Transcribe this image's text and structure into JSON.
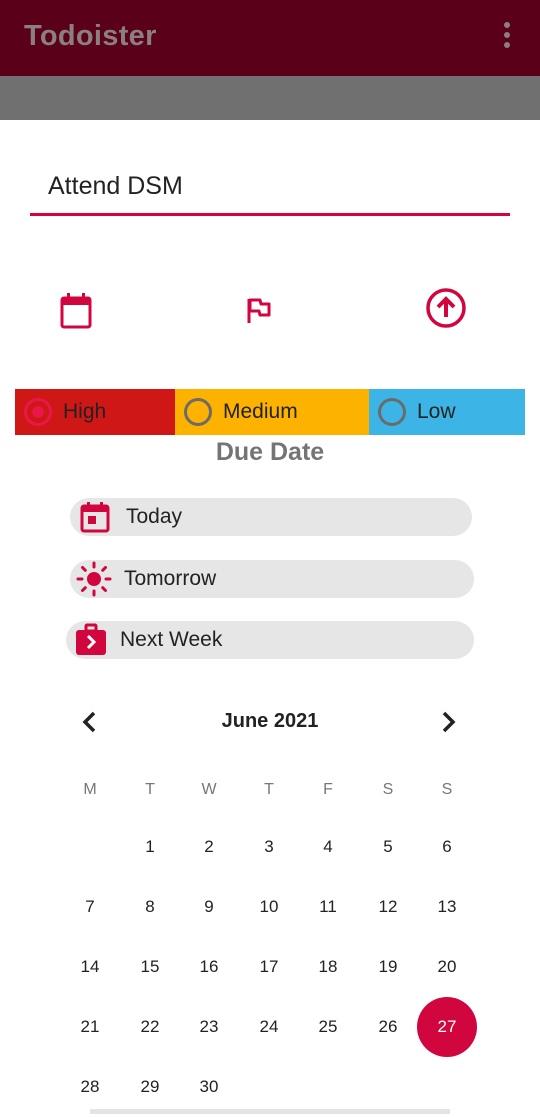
{
  "app": {
    "title": "Todoister",
    "menu_icon": "more-vert-icon"
  },
  "task": {
    "value": "Attend DSM"
  },
  "actions": [
    {
      "name": "calendar-icon"
    },
    {
      "name": "flag-icon"
    },
    {
      "name": "save-arrow-up-icon"
    }
  ],
  "priority": {
    "options": [
      {
        "label": "High",
        "color": "#cf1716",
        "selected": true
      },
      {
        "label": "Medium",
        "color": "#feb200",
        "selected": false
      },
      {
        "label": "Low",
        "color": "#3cb5e6",
        "selected": false
      }
    ]
  },
  "due": {
    "title": "Due Date",
    "chips": [
      {
        "label": "Today",
        "icon": "calendar-today-icon"
      },
      {
        "label": "Tomorrow",
        "icon": "sun-icon"
      },
      {
        "label": "Next Week",
        "icon": "briefcase-arrow-icon"
      }
    ]
  },
  "calendar": {
    "month": "June 2021",
    "weekdays": [
      "M",
      "T",
      "W",
      "T",
      "F",
      "S",
      "S"
    ],
    "first_weekday_offset": 1,
    "days_in_month": 30,
    "selected_day": 27
  },
  "colors": {
    "accent": "#d1063f",
    "appbar": "#5a0018"
  }
}
